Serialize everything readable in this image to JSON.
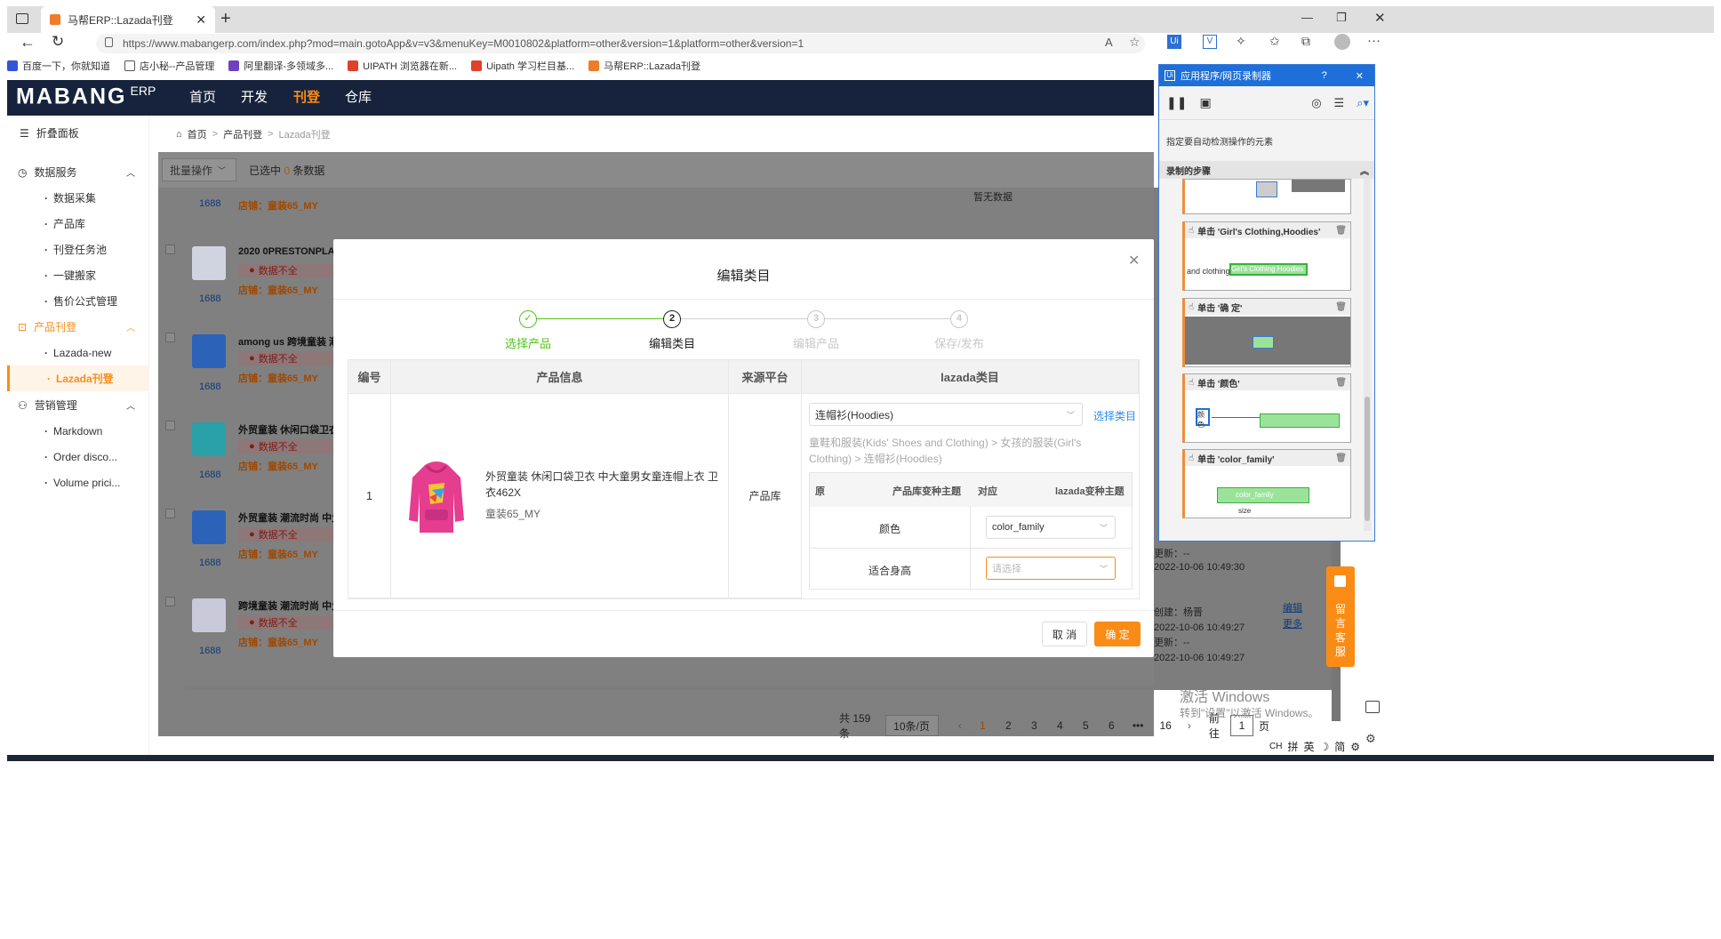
{
  "browser": {
    "tab_title": "马帮ERP::Lazada刊登",
    "url": "https://www.mabangerp.com/index.php?mod=main.gotoApp&v=v3&menuKey=M0010802&platform=other&version=1&platform=other&version=1",
    "bookmarks": [
      "百度一下，你就知道",
      "店小秘--产品管理",
      "阿里翻译-多领域多...",
      "UIPATH 浏览器在新...",
      "Uipath 学习栏目基...",
      "马帮ERP::Lazada刊登"
    ]
  },
  "app": {
    "logo": "MABANG",
    "logo_sub": "ERP",
    "nav": [
      "首页",
      "开发",
      "刊登",
      "仓库"
    ]
  },
  "sidebar": {
    "collapse": "折叠面板",
    "groups": [
      {
        "label": "数据服务",
        "items": [
          "数据采集",
          "产品库",
          "刊登任务池",
          "一键搬家",
          "售价公式管理"
        ]
      },
      {
        "label": "产品刊登",
        "items": [
          "Lazada-new",
          "Lazada刊登"
        ]
      },
      {
        "label": "营销管理",
        "items": [
          "Markdown",
          "Order disco...",
          "Volume prici..."
        ]
      }
    ]
  },
  "breadcrumb": [
    "首页",
    "产品刊登",
    "Lazada刊登"
  ],
  "toolbar": {
    "batch": "批量操作",
    "selected_pre": "已选中",
    "selected_count": "0",
    "selected_post": "条数据"
  },
  "list": {
    "no_data": "暂无数据",
    "rows": [
      {
        "title": "2020 0PRESTONPLAY",
        "warn": "数据不全",
        "shop": "店铺：童装65_MY",
        "src": "1688"
      },
      {
        "title": "among us 跨境童装 潮",
        "warn": "数据不全",
        "shop": "店铺：童装65_MY",
        "src": "1688"
      },
      {
        "title": "外贸童装 休闲口袋卫衣",
        "warn": "数据不全",
        "shop": "店铺：童装65_MY",
        "src": "1688"
      },
      {
        "title": "外贸童装 潮流时尚 中大",
        "warn": "数据不全",
        "shop": "店铺：童装65_MY",
        "src": "1688"
      },
      {
        "title": "跨境童装 潮流时尚 中大",
        "warn": "数据不全",
        "shop": "店铺：童装65_MY",
        "src": "1688"
      }
    ],
    "first_shop": "店铺：童装65_MY",
    "first_src": "1688",
    "right_info": {
      "update1": "更新：--",
      "time1": "2022-10-06 10:49:30",
      "creator": "创建：杨晋",
      "time2": "2022-10-06 10:49:27",
      "update2": "更新：--",
      "time3": "2022-10-06 10:49:27",
      "edit": "编辑",
      "more": "更多"
    },
    "pagination": {
      "total": "共 159 条",
      "size": "10条/页",
      "pages": [
        "1",
        "2",
        "3",
        "4",
        "5",
        "6",
        "•••",
        "16"
      ],
      "goto": "前往",
      "goto_val": "1",
      "page_word": "页"
    }
  },
  "modal": {
    "title": "编辑类目",
    "steps": [
      {
        "num": "✓",
        "label": "选择产品",
        "state": "done"
      },
      {
        "num": "2",
        "label": "编辑类目",
        "state": "active"
      },
      {
        "num": "3",
        "label": "编辑产品",
        "state": "todo"
      },
      {
        "num": "4",
        "label": "保存/发布",
        "state": "todo"
      }
    ],
    "headers": [
      "编号",
      "产品信息",
      "来源平台",
      "lazada类目"
    ],
    "row": {
      "no": "1",
      "name": "外贸童装 休闲口袋卫衣 中大童男女童连帽上衣 卫衣462X",
      "shop": "童装65_MY",
      "source": "产品库",
      "category": "连帽衫(Hoodies)",
      "choose": "选择类目",
      "path": "童鞋和服装(Kids' Shoes and Clothing) > 女孩的服装(Girl's Clothing) > 连帽衫(Hoodies)",
      "variant_head": [
        "原",
        "产品库变种主题",
        "对应",
        "lazada变种主题"
      ],
      "variants": [
        {
          "name": "颜色",
          "value": "color_family",
          "placeholder": ""
        },
        {
          "name": "适合身高",
          "value": "",
          "placeholder": "请选择"
        }
      ]
    },
    "cancel": "取 消",
    "ok": "确 定"
  },
  "recorder": {
    "title": "应用程序/网页录制器",
    "hint": "指定要自动检测操作的元素",
    "steps_label": "录制的步骤",
    "cards": [
      "单击 'Girl's Clothing,Hoodies'",
      "单击 '确 定'",
      "单击 '颜色'",
      "单击 'color_family'"
    ],
    "snippets": [
      "and clothing",
      "Girl's Clothing Hoodies",
      "color_family",
      "size",
      "颜色"
    ]
  },
  "feedback": "留言客服",
  "windows_watermark": {
    "line1": "激活 Windows",
    "line2": "转到\"设置\"以激活 Windows。"
  },
  "taskbar": [
    "CH",
    "拼",
    "英",
    "简"
  ],
  "colors": {
    "accent": "#fa8c16",
    "header": "#17233d",
    "success": "#52c41a",
    "link": "#2d8cf0"
  }
}
